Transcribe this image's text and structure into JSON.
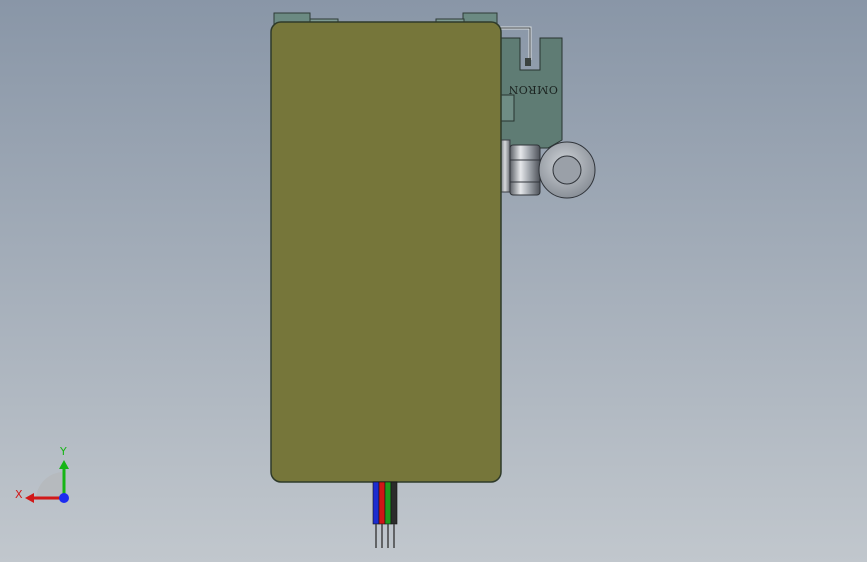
{
  "viewport": {
    "background_top": "#8996a7",
    "background_bottom": "#c1c7cd"
  },
  "model": {
    "body_color": "#76763a",
    "body_edge": "#2f3a2a",
    "clip_color": "#6b8a82",
    "bracket_color": "#5f7c74",
    "brand_label": "OMRON",
    "wire_colors": [
      "#1d2ccf",
      "#d01616",
      "#1f9a1f",
      "#2b2b2b"
    ]
  },
  "triad": {
    "x_label": "X",
    "y_label": "Y",
    "x_color": "#d11818",
    "y_color": "#16b516",
    "z_color": "#1d2cf0"
  }
}
